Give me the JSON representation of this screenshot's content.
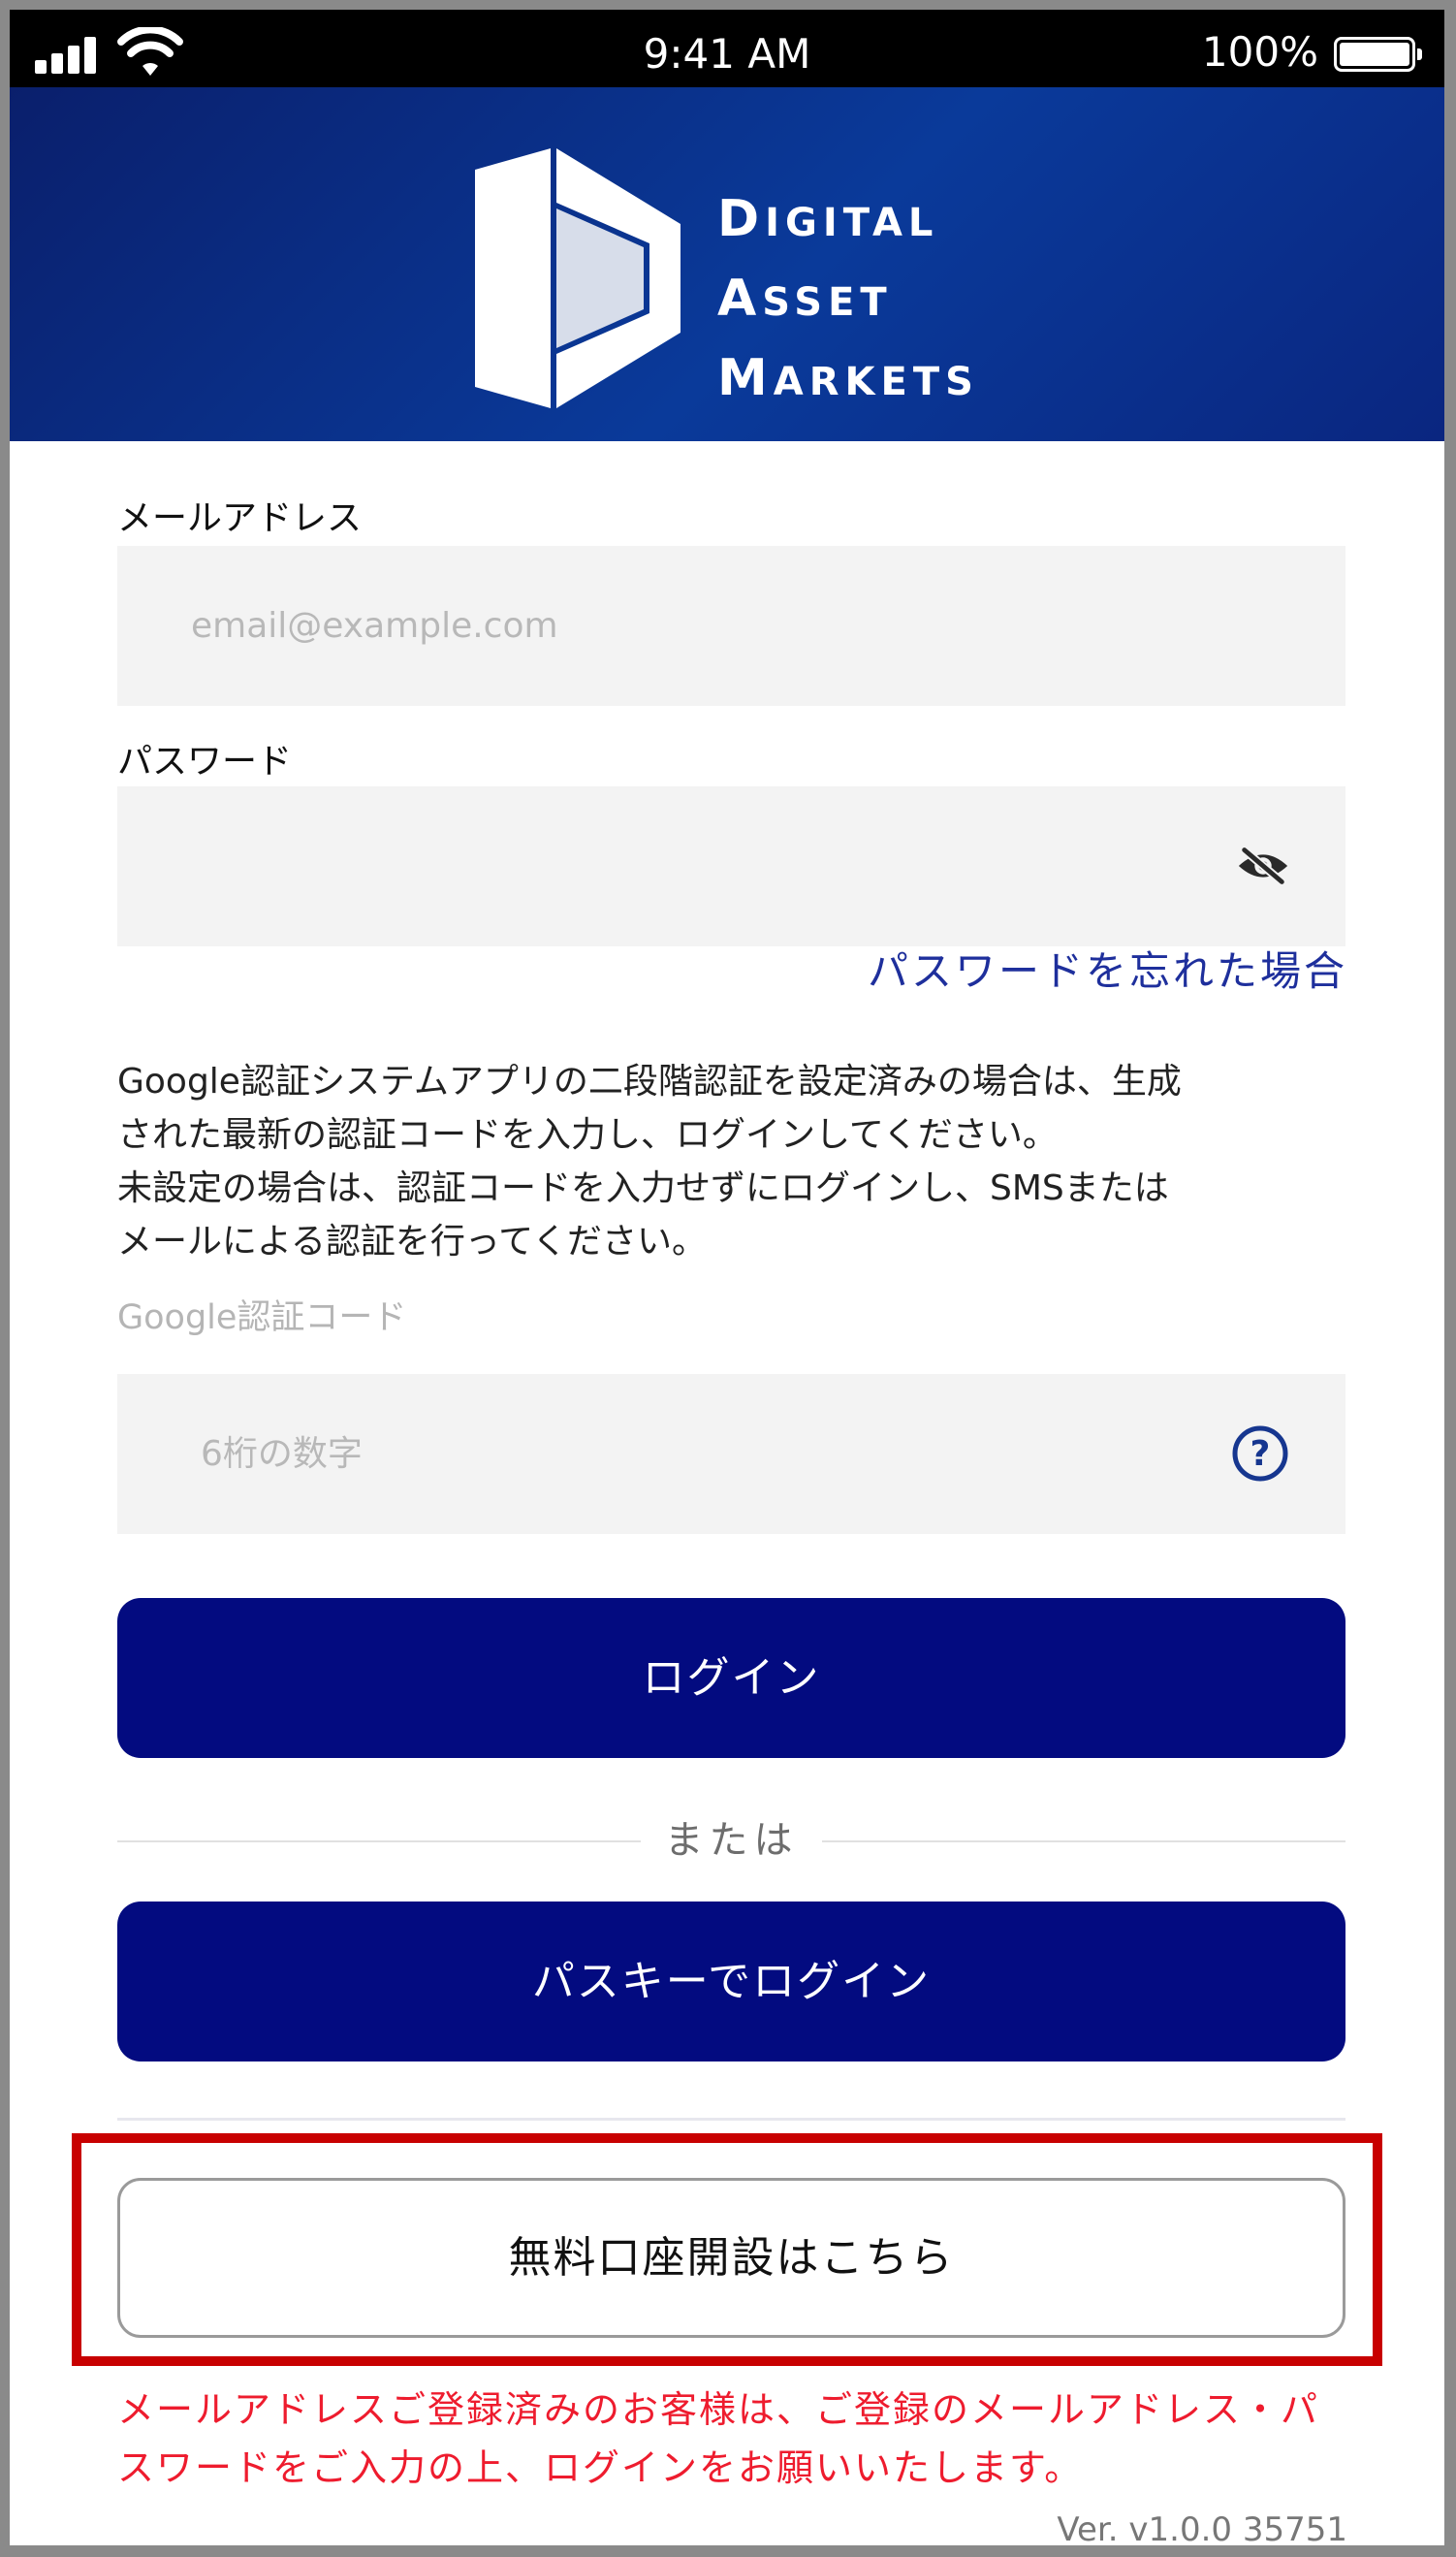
{
  "status_bar": {
    "time": "9:41 AM",
    "battery": "100%"
  },
  "header": {
    "logo": {
      "line1_cap": "D",
      "line1_rest": "IGITAL",
      "line2_cap": "A",
      "line2_rest": "SSET",
      "line3_cap": "M",
      "line3_rest": "ARKETS"
    },
    "background_color": "#0a2a8a"
  },
  "form": {
    "email": {
      "label": "メールアドレス",
      "placeholder": "email@example.com",
      "value": ""
    },
    "password": {
      "label": "パスワード",
      "value": "",
      "toggle_icon": "eye-slash-icon"
    },
    "forgot_password_link": "パスワードを忘れた場合",
    "notice_lines": [
      "Google認証システムアプリの二段階認証を設定済みの場合は、生成",
      "された最新の認証コードを入力し、ログインしてください。",
      "未設定の場合は、認証コードを入力せずにログインし、SMSまたは",
      "メールによる認証を行ってください。"
    ],
    "google_code": {
      "label": "Google認証コード",
      "placeholder": "6桁の数字",
      "value": "",
      "help_icon": "question-circle-icon"
    }
  },
  "buttons": {
    "login": "ログイン",
    "or_separator": "または",
    "passkey_login": "パスキーでログイン",
    "open_account": "無料口座開設はこちら"
  },
  "warning_lines": [
    "メールアドレスご登録済みのお客様は、ご登録のメールアドレス・パ",
    "スワードをご入力の上、ログインをお願いいたします。"
  ],
  "version": "Ver. v1.0.0 35751",
  "colors": {
    "primary_button": "#030b80",
    "link": "#1e2f9c",
    "warning_text": "#ee1c2e",
    "highlight_frame": "#c80000",
    "input_background": "#f3f3f3"
  }
}
